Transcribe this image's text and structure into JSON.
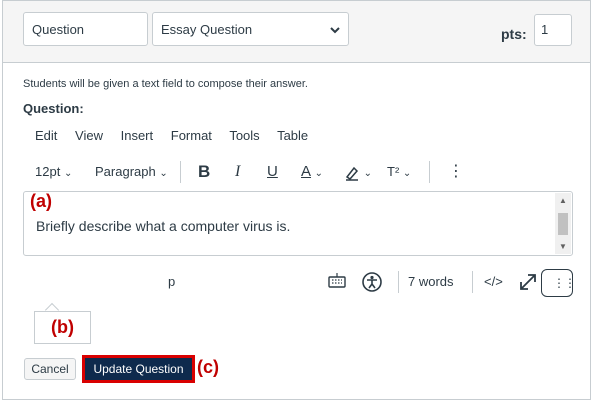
{
  "header": {
    "question_name_value": "Question",
    "question_type_value": "Essay Question",
    "pts_label": "pts:",
    "pts_value": "1"
  },
  "description": "Students will be given a text field to compose their answer.",
  "question_label": "Question:",
  "menubar": [
    "Edit",
    "View",
    "Insert",
    "Format",
    "Tools",
    "Table"
  ],
  "toolbar": {
    "font_size": "12pt",
    "block_format": "Paragraph",
    "bold": "B",
    "italic": "I",
    "underline": "U",
    "text_color": "A",
    "superscript": "T²",
    "more": "⋮"
  },
  "editor": {
    "content": "Briefly describe what a computer virus is."
  },
  "statusbar": {
    "path": "p",
    "word_count": "7 words",
    "html_toggle": "</>"
  },
  "annotations": {
    "a": "(a)",
    "b": "(b)",
    "c": "(c)"
  },
  "buttons": {
    "cancel": "Cancel",
    "update": "Update Question"
  },
  "colors": {
    "annotation_red": "#c00000",
    "update_button_bg": "#0e2a4d",
    "border": "#c7cdd1"
  }
}
